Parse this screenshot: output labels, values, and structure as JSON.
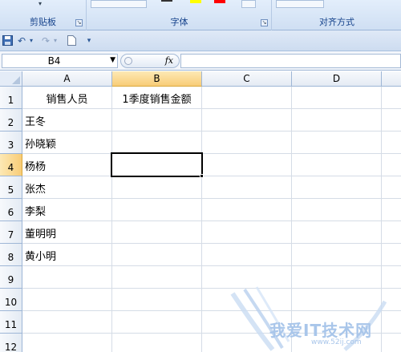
{
  "ribbon": {
    "groups": [
      {
        "label": "剪贴板"
      },
      {
        "label": "字体"
      },
      {
        "label": "对齐方式"
      }
    ],
    "colors": {
      "highlight": "#ffff00",
      "font_color": "#ff0000"
    }
  },
  "qat": {
    "icons": [
      "save-icon",
      "undo-icon",
      "redo-icon",
      "new-document-icon",
      "customize-qat-icon"
    ]
  },
  "formula_bar": {
    "name_box": "B4",
    "fx_label": "fx",
    "formula": ""
  },
  "sheet": {
    "columns": [
      "A",
      "B",
      "C",
      "D"
    ],
    "selected_column": "B",
    "rows": [
      {
        "num": "1",
        "A": "销售人员",
        "B": "1季度销售金额"
      },
      {
        "num": "2",
        "A": "王冬",
        "B": ""
      },
      {
        "num": "3",
        "A": "孙晓颖",
        "B": ""
      },
      {
        "num": "4",
        "A": "杨杨",
        "B": ""
      },
      {
        "num": "5",
        "A": "张杰",
        "B": ""
      },
      {
        "num": "6",
        "A": "李梨",
        "B": ""
      },
      {
        "num": "7",
        "A": "董明明",
        "B": ""
      },
      {
        "num": "8",
        "A": "黄小明",
        "B": ""
      },
      {
        "num": "9",
        "A": "",
        "B": ""
      },
      {
        "num": "10",
        "A": "",
        "B": ""
      },
      {
        "num": "11",
        "A": "",
        "B": ""
      },
      {
        "num": "12",
        "A": "",
        "B": ""
      }
    ],
    "selected_row": "4",
    "active_cell": "B4"
  },
  "watermark": {
    "text": "我爱IT技术网",
    "url": "www.52ij.com"
  }
}
